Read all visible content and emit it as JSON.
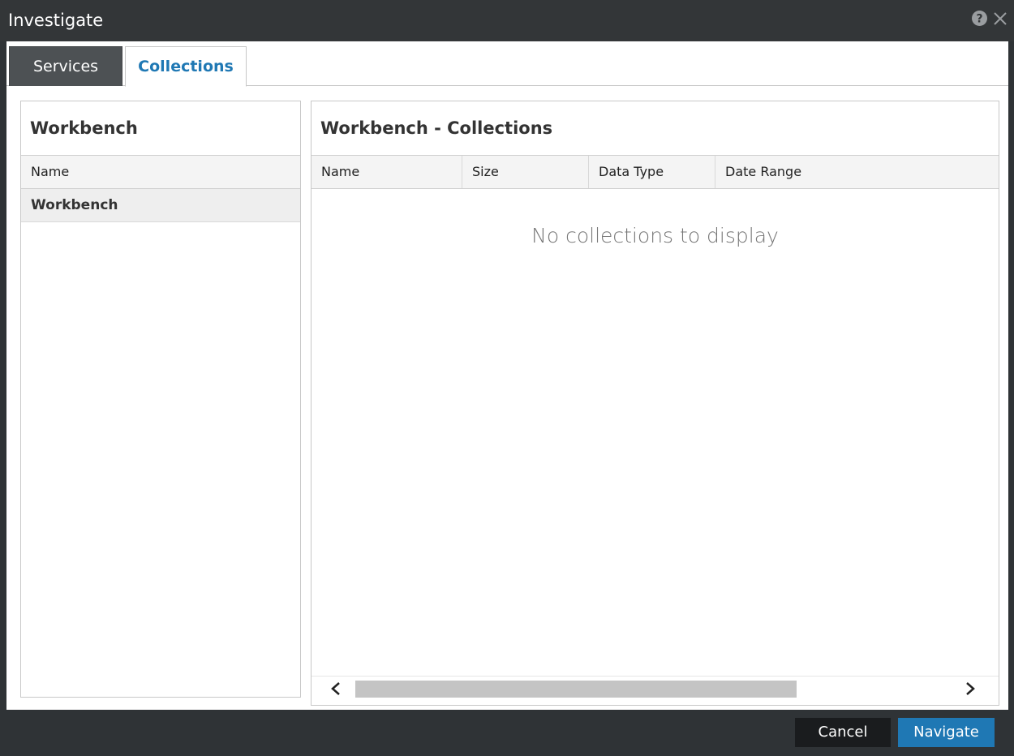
{
  "window": {
    "title": "Investigate"
  },
  "tabs": [
    {
      "label": "Services",
      "active": false
    },
    {
      "label": "Collections",
      "active": true
    }
  ],
  "left_panel": {
    "title": "Workbench",
    "column_header": "Name",
    "rows": [
      {
        "label": "Workbench",
        "selected": true
      }
    ]
  },
  "right_panel": {
    "title": "Workbench - Collections",
    "columns": [
      "Name",
      "Size",
      "Data Type",
      "Date Range"
    ],
    "empty_message": "No collections to display"
  },
  "footer": {
    "cancel_label": "Cancel",
    "navigate_label": "Navigate"
  },
  "colors": {
    "titlebar": "#333638",
    "accent": "#1f78b4",
    "inactive_tab": "#4d5154",
    "cancel_button": "#1a1c1e"
  },
  "icons": [
    "help-icon",
    "close-icon",
    "chevron-left-icon",
    "chevron-right-icon"
  ]
}
